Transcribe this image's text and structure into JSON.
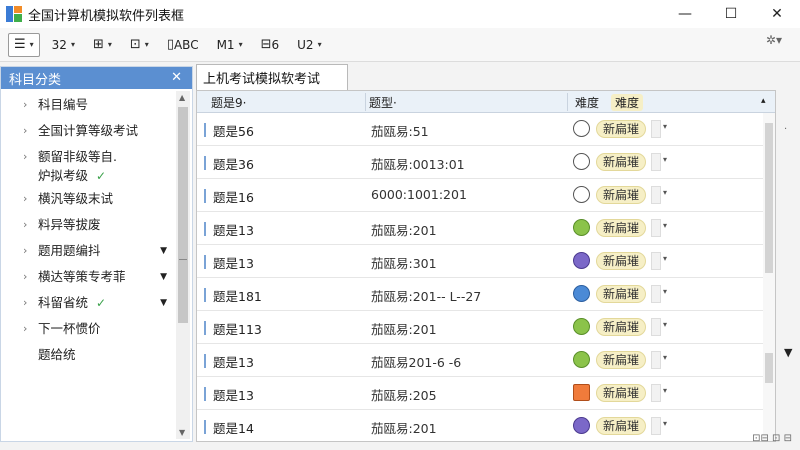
{
  "window": {
    "title": "全国计算机模拟软件列表框",
    "minimize": "—",
    "maximize": "☐",
    "close": "✕"
  },
  "toolbar": {
    "items": [
      {
        "label": "",
        "icon": "list-icon",
        "glyph": "☰",
        "caret": "▾",
        "boxed": true
      },
      {
        "label": "32",
        "icon": "",
        "glyph": "",
        "caret": "▾",
        "boxed": false
      },
      {
        "label": "",
        "icon": "hierarchy-icon",
        "glyph": "⊞",
        "caret": "▾",
        "boxed": false
      },
      {
        "label": "",
        "icon": "gift-icon",
        "glyph": "⊡",
        "caret": "▾",
        "boxed": false
      },
      {
        "label": "ABC",
        "icon": "text-format-icon",
        "glyph": "▯",
        "caret": "",
        "boxed": false
      },
      {
        "label": "M1",
        "icon": "",
        "glyph": "",
        "caret": "▾",
        "boxed": false
      },
      {
        "label": "6",
        "icon": "column-icon",
        "glyph": "⊟",
        "caret": "",
        "boxed": false
      },
      {
        "label": "U2",
        "icon": "",
        "glyph": "",
        "caret": "▾",
        "boxed": false
      }
    ],
    "right_icon": "settings-icon",
    "right_glyph": "✲▾"
  },
  "sidebar": {
    "title": "科目分类",
    "close": "✕",
    "items": [
      {
        "label": "科目编号",
        "chevron": true,
        "check": false,
        "arrow": false,
        "lines": [
          "科目编号"
        ]
      },
      {
        "label": "全国计算等级考试",
        "chevron": true,
        "check": false,
        "arrow": false,
        "lines": [
          "全国计算等级考试"
        ]
      },
      {
        "label": "额留非级等自.",
        "chevron": true,
        "check": true,
        "arrow": false,
        "lines": [
          "额留非级等自.",
          "炉拟考级"
        ]
      },
      {
        "label": "横汎等级末试",
        "chevron": true,
        "check": false,
        "arrow": false,
        "lines": [
          "横汎等级末试"
        ]
      },
      {
        "label": "料异等拔废",
        "chevron": true,
        "check": false,
        "arrow": false,
        "lines": [
          "料异等拔废"
        ]
      },
      {
        "label": "题用题编抖",
        "chevron": true,
        "check": false,
        "arrow": true,
        "lines": [
          "题用题编抖"
        ]
      },
      {
        "label": "横达等策专考菲",
        "chevron": true,
        "check": false,
        "arrow": true,
        "lines": [
          "横达等策专考菲"
        ]
      },
      {
        "label": "科留省统",
        "chevron": true,
        "check": true,
        "arrow": true,
        "lines": [
          "科留省统"
        ]
      },
      {
        "label": "下一杯惯价",
        "chevron": true,
        "check": false,
        "arrow": false,
        "lines": [
          "下一杯惯价"
        ]
      },
      {
        "label": "题给统",
        "chevron": false,
        "check": false,
        "arrow": false,
        "lines": [
          "题给统"
        ]
      }
    ],
    "check_glyph": "✓",
    "chevron_glyph": "›",
    "arrow_glyph": "▼"
  },
  "main": {
    "tab_label": "上机考试模拟软考试",
    "columns": {
      "col1": "题是9·",
      "col2": "题型·",
      "col3a": "难度",
      "col3b": "难度",
      "sort": "▴"
    },
    "rows": [
      {
        "id": "题是56",
        "type": "茄瓯易:51",
        "status_icon": "circle-icon",
        "status_class": "si-circle",
        "status": "新扁璀"
      },
      {
        "id": "题是36",
        "type": "茄瓯易:0013:01",
        "status_icon": "circle-icon",
        "status_class": "si-circle",
        "status": "新扁璀"
      },
      {
        "id": "题是16",
        "type": "6000:1001:201",
        "status_icon": "circle-icon",
        "status_class": "si-circle",
        "status": "新扁璀"
      },
      {
        "id": "题是13",
        "type": "茄瓯易:201",
        "status_icon": "green-compass-icon",
        "status_class": "si-green",
        "status": "新扁璀"
      },
      {
        "id": "题是13",
        "type": "茄瓯易:301",
        "status_icon": "purple-swirl-icon",
        "status_class": "si-purple",
        "status": "新扁璀"
      },
      {
        "id": "题是181",
        "type": "茄瓯易:201-- L--27",
        "status_icon": "blue-puzzle-icon",
        "status_class": "si-blue",
        "status": "新扁璀"
      },
      {
        "id": "题是113",
        "type": "茄瓯易:201",
        "status_icon": "green-compass-icon",
        "status_class": "si-green",
        "status": "新扁璀"
      },
      {
        "id": "题是13",
        "type": "茄瓯易201-6 -6",
        "status_icon": "green-compass-icon",
        "status_class": "si-green",
        "status": "新扁璀"
      },
      {
        "id": "题是13",
        "type": "茄瓯易:205",
        "status_icon": "orange-tile-icon",
        "status_class": "si-orange",
        "status": "新扁璀"
      },
      {
        "id": "题是14",
        "type": "茄瓯易:201",
        "status_icon": "purple-swirl-icon",
        "status_class": "si-purple",
        "status": "新扁璀"
      }
    ],
    "row_caret": "▾"
  },
  "statusbar": {
    "icons": "⊡⊟ ⊡ ⊟"
  }
}
